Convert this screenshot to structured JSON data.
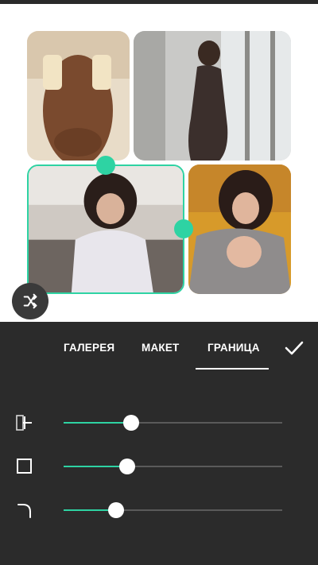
{
  "colors": {
    "accent": "#2ed3a3",
    "panel": "#2b2b2b",
    "track": "#5a5a5a"
  },
  "photos": [
    {
      "name": "photo-topleft",
      "selected": false
    },
    {
      "name": "photo-topright",
      "selected": false
    },
    {
      "name": "photo-bottomleft",
      "selected": true
    },
    {
      "name": "photo-bottomright",
      "selected": false
    }
  ],
  "shuffle_button": {
    "icon": "shuffle-icon"
  },
  "tabs": [
    {
      "id": "gallery",
      "label": "ГАЛЕРЕЯ",
      "active": false
    },
    {
      "id": "layout",
      "label": "МАКЕТ",
      "active": false
    },
    {
      "id": "border",
      "label": "ГРАНИЦА",
      "active": true
    }
  ],
  "confirm_button": {
    "icon": "checkmark-icon"
  },
  "sliders": [
    {
      "id": "spacing",
      "icon": "spacing-icon",
      "value": 0.31
    },
    {
      "id": "border-width",
      "icon": "square-frame-icon",
      "value": 0.29
    },
    {
      "id": "corner-radius",
      "icon": "corner-radius-icon",
      "value": 0.24
    }
  ]
}
